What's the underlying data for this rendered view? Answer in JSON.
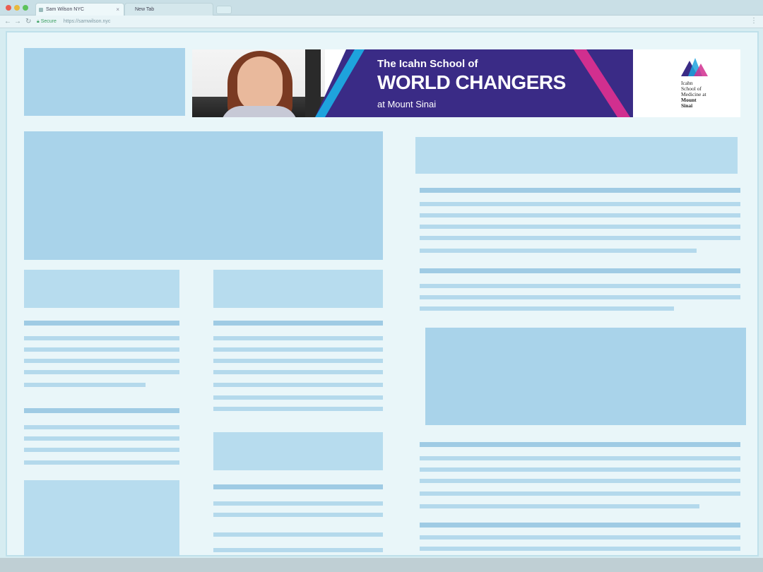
{
  "browser": {
    "tabs": [
      {
        "label": "Sam Wilson NYC",
        "active": true
      },
      {
        "label": "New Tab",
        "active": false
      }
    ],
    "address": {
      "secure_label": "Secure",
      "url": "https://samwilson.nyc"
    }
  },
  "ad": {
    "line1": "The Icahn School of",
    "line2": "WORLD CHANGERS",
    "line3": "at Mount Sinai",
    "logo_line1": "Icahn",
    "logo_line2": "School of",
    "logo_line3": "Medicine at",
    "logo_line4": "Mount",
    "logo_line5": "Sinai",
    "colors": {
      "band": "#3a2b86",
      "stripe_cyan": "#1ea3dd",
      "stripe_magenta": "#d12f8f"
    }
  },
  "icons": [
    "close-icon",
    "back-icon",
    "forward-icon",
    "reload-icon",
    "lock-icon",
    "menu-icon"
  ]
}
